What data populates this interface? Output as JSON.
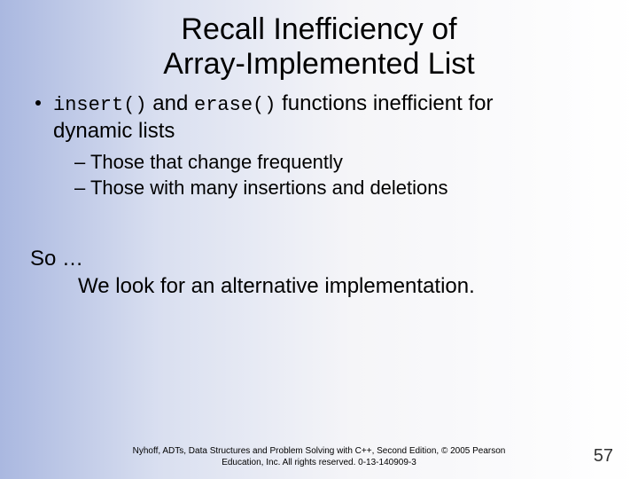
{
  "title_line1": "Recall Inefficiency of",
  "title_line2": "Array-Implemented List",
  "bullet": {
    "code1": "insert()",
    "mid1": " and ",
    "code2": "erase()",
    "tail": " functions inefficient for",
    "line2": "dynamic lists"
  },
  "sub1": "– Those that change frequently",
  "sub2": "– Those with many insertions and deletions",
  "so_line1": "So  …",
  "so_line2": "We look for an alternative implementation.",
  "footer_line1": "Nyhoff, ADTs, Data Structures and Problem Solving with C++, Second Edition, © 2005 Pearson",
  "footer_line2": "Education, Inc. All rights reserved. 0-13-140909-3",
  "page_number": "57"
}
